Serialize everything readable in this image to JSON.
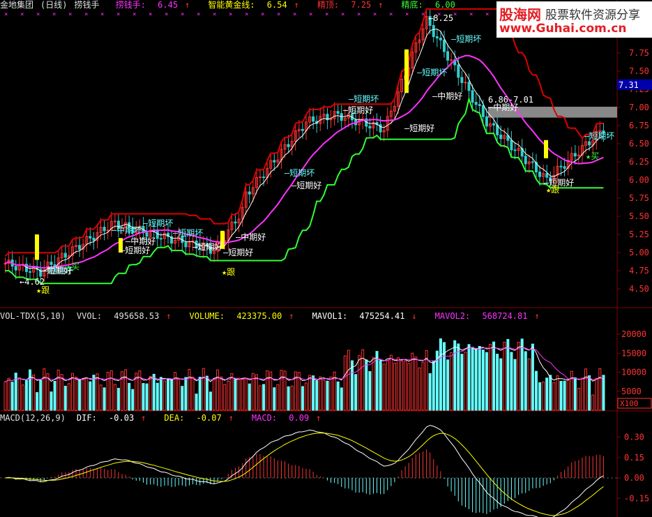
{
  "main": {
    "stock_name": "金地集团",
    "period": "(日线)",
    "indicator": "捞钱手",
    "indicators": [
      {
        "label": "捞钱手:",
        "value": "6.45",
        "arrow": "↑",
        "label_color": "#ff33ff",
        "value_color": "#ff33ff"
      },
      {
        "label": "智能黄金线:",
        "value": "6.54",
        "arrow": "↑",
        "label_color": "#ffff00",
        "value_color": "#ffff00"
      },
      {
        "label": "精顶:",
        "value": "7.25",
        "arrow": "↑",
        "label_color": "#ff3333",
        "value_color": "#ff3333"
      },
      {
        "label": "精底:",
        "value": "6.00",
        "arrow": "",
        "label_color": "#33ff33",
        "value_color": "#33ff33"
      }
    ],
    "y_axis": [
      "7.75",
      "7.50",
      "7.25",
      "7.00",
      "6.75",
      "6.50",
      "6.25",
      "6.00",
      "5.75",
      "5.50",
      "5.25",
      "5.00",
      "4.75",
      "4.50"
    ],
    "current_price": "7.31",
    "high_label": "8.25",
    "low_label": "4.62",
    "range_label": "6.86-7.01",
    "annotations": [
      {
        "text": "—短期坏",
        "color": "#66ffff"
      },
      {
        "text": "—短期好",
        "color": "#ffffff"
      },
      {
        "text": "—中期坏",
        "color": "#66ffff"
      },
      {
        "text": "—中期好",
        "color": "#ffffff"
      },
      {
        "text": "★买",
        "color": "#33ff33"
      },
      {
        "text": "★跟",
        "color": "#ffff00"
      },
      {
        "text": "—短期坏",
        "color": "#66ffff"
      },
      {
        "text": "—短期好",
        "color": "#ffffff"
      },
      {
        "text": "—短期好",
        "color": "#ffffff"
      },
      {
        "text": "—短期坏",
        "color": "#66ffff"
      },
      {
        "text": "—短期好",
        "color": "#ffffff"
      },
      {
        "text": "—中期好",
        "color": "#ffffff"
      },
      {
        "text": "★跟",
        "color": "#ffff00"
      },
      {
        "text": "—短期坏",
        "color": "#66ffff"
      },
      {
        "text": "—短期好",
        "color": "#ffffff"
      },
      {
        "text": "—短期坏",
        "color": "#66ffff"
      },
      {
        "text": "—短期好",
        "color": "#ffffff"
      },
      {
        "text": "—中期好",
        "color": "#ffffff"
      },
      {
        "text": "—短期坏",
        "color": "#66ffff"
      },
      {
        "text": "—短期坏",
        "color": "#66ffff"
      },
      {
        "text": "—短期好",
        "color": "#ffffff"
      },
      {
        "text": "—中期好",
        "color": "#ffffff"
      },
      {
        "text": "—短期好",
        "color": "#ffffff"
      },
      {
        "text": "★跟",
        "color": "#ffff00"
      },
      {
        "text": "—短期坏",
        "color": "#66ffff"
      },
      {
        "text": "★买",
        "color": "#33ff33"
      }
    ]
  },
  "vol": {
    "title": "VOL-TDX(5,10)",
    "items": [
      {
        "label": "VVOL:",
        "value": "495658.53",
        "arrow": "↑",
        "color": "#e0e0e0"
      },
      {
        "label": "VOLUME:",
        "value": "423375.00",
        "arrow": "↑",
        "color": "#ffff00"
      },
      {
        "label": "MAVOL1:",
        "value": "475254.41",
        "arrow": "↓",
        "color": "#ffffff"
      },
      {
        "label": "MAVOL2:",
        "value": "568724.81",
        "arrow": "↑",
        "color": "#ff33ff"
      }
    ],
    "y_axis": [
      "20000",
      "15000",
      "10000",
      "5000"
    ],
    "unit": "X100"
  },
  "macd": {
    "title": "MACD(12,26,9)",
    "items": [
      {
        "label": "DIF:",
        "value": "-0.03",
        "arrow": "↑",
        "color": "#ffffff"
      },
      {
        "label": "DEA:",
        "value": "-0.07",
        "arrow": "↑",
        "color": "#ffff00"
      },
      {
        "label": "MACD:",
        "value": "0.09",
        "arrow": "↑",
        "color": "#ff33ff"
      }
    ],
    "y_axis": [
      "0.30",
      "0.15",
      "0.00",
      "-0.15"
    ]
  },
  "logo": {
    "brand": "股海网",
    "slogan": "股票软件资源分享",
    "url": "www.Guhai.com.cn"
  },
  "colors": {
    "grid": "#7f0000",
    "up": "#ff3333",
    "down": "#33cccc",
    "vol_up": "#ff3333",
    "vol_down": "#66ffff",
    "top_line": "#dd0000",
    "bottom_line": "#33ff33",
    "ma_line": "#ff33ff",
    "white_line": "#ffffff"
  }
}
